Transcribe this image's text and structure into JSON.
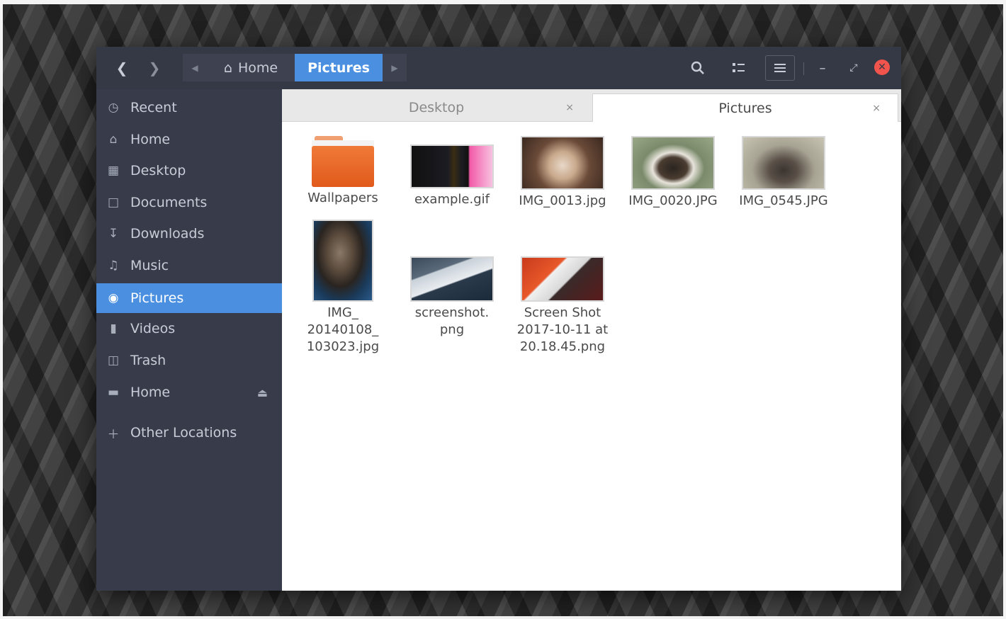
{
  "headerbar": {
    "path": [
      {
        "label": "Home",
        "icon": "home-icon"
      },
      {
        "label": "Pictures",
        "active": true
      }
    ],
    "icons": [
      "back-arrow-icon",
      "forward-arrow-icon",
      "search-icon",
      "view-toggle-icon",
      "hamburger-menu-icon",
      "minimize-icon",
      "maximize-icon",
      "close-icon"
    ]
  },
  "sidebar": {
    "items": [
      {
        "label": "Recent",
        "icon": "clock-icon"
      },
      {
        "label": "Home",
        "icon": "home-icon"
      },
      {
        "label": "Desktop",
        "icon": "folder-icon"
      },
      {
        "label": "Documents",
        "icon": "document-icon"
      },
      {
        "label": "Downloads",
        "icon": "download-icon"
      },
      {
        "label": "Music",
        "icon": "music-icon"
      },
      {
        "label": "Pictures",
        "icon": "camera-icon",
        "active": true
      },
      {
        "label": "Videos",
        "icon": "video-icon"
      },
      {
        "label": "Trash",
        "icon": "trash-icon"
      },
      {
        "label": "Home",
        "icon": "drive-icon",
        "eject": true
      },
      {
        "label": "Other Locations",
        "icon": "plus-icon"
      }
    ]
  },
  "tabs": [
    {
      "label": "Desktop",
      "close": "×"
    },
    {
      "label": "Pictures",
      "close": "×",
      "active": true
    }
  ],
  "files": [
    {
      "name": "Wallpapers",
      "type": "folder"
    },
    {
      "name": "example.gif",
      "type": "image"
    },
    {
      "name": "IMG_0013.jpg",
      "type": "image"
    },
    {
      "name": "IMG_0020.JPG",
      "type": "image"
    },
    {
      "name": "IMG_0545.JPG",
      "type": "image"
    },
    {
      "name": "IMG_\n20140108_\n103023.jpg",
      "type": "image"
    },
    {
      "name": "screenshot.\npng",
      "type": "image"
    },
    {
      "name": "Screen Shot\n2017-10-11 at\n20.18.45.png",
      "type": "image"
    }
  ],
  "colors": {
    "headerbar": "#353945",
    "sidebar": "#383c4a",
    "accent": "#4a8fe0",
    "close": "#f0544c"
  }
}
